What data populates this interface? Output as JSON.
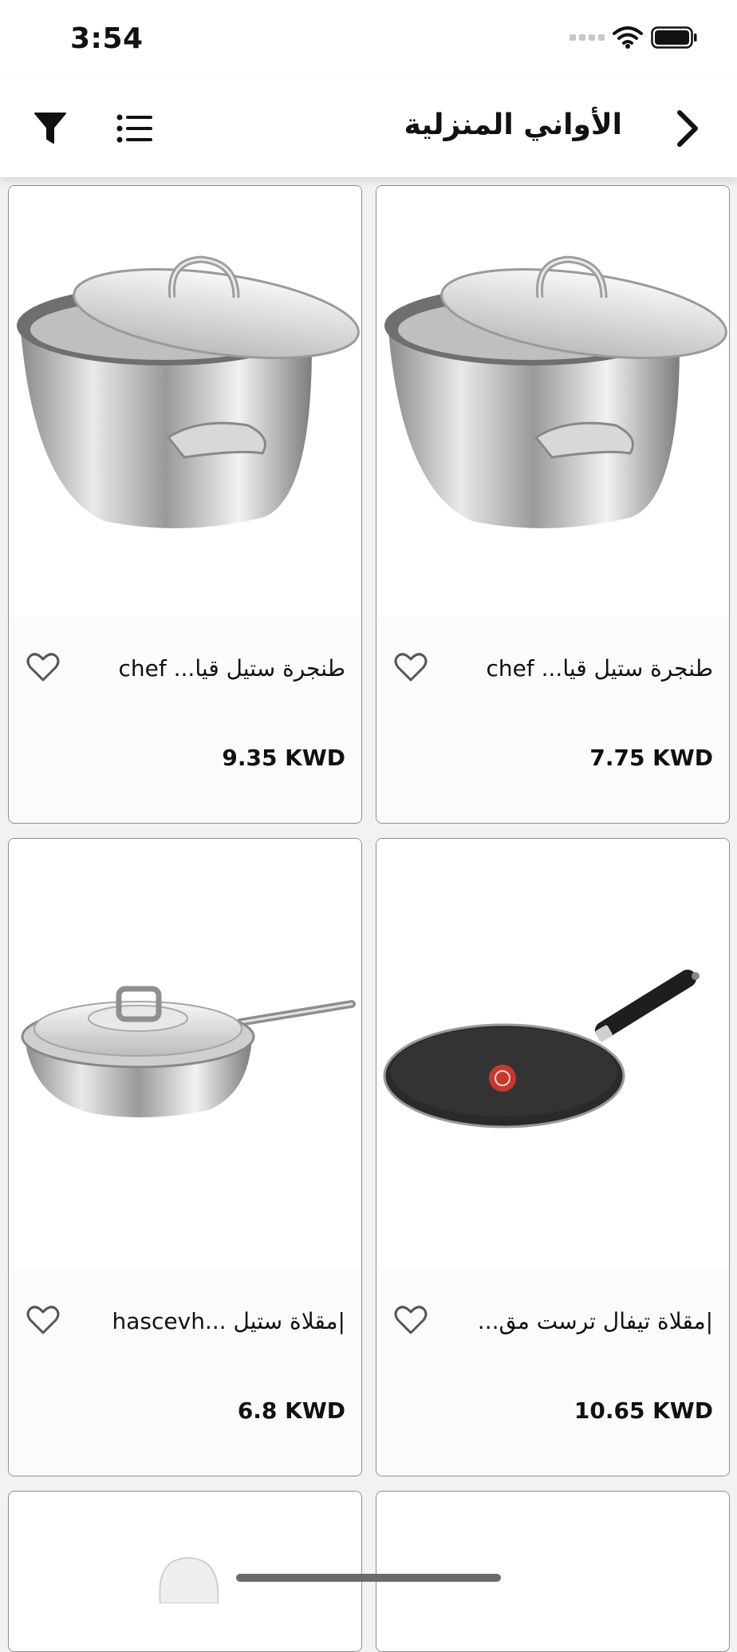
{
  "status_bar": {
    "time": "3:54"
  },
  "header": {
    "title": "الأواني المنزلية"
  },
  "products": [
    {
      "name": "طنجرة ستيل قيا... chef",
      "price": "9.35 KWD",
      "image": "stock-pot-with-lid"
    },
    {
      "name": "طنجرة ستيل قيا... chef",
      "price": "7.75 KWD",
      "image": "stock-pot-with-lid"
    },
    {
      "name": "|مقلاة ستيل ...hascevh",
      "price": "6.8 KWD",
      "image": "saute-pan-with-lid"
    },
    {
      "name": "|مقلاة تيفال ترست مق...",
      "price": "10.65 KWD",
      "image": "flat-crepe-pan"
    }
  ]
}
